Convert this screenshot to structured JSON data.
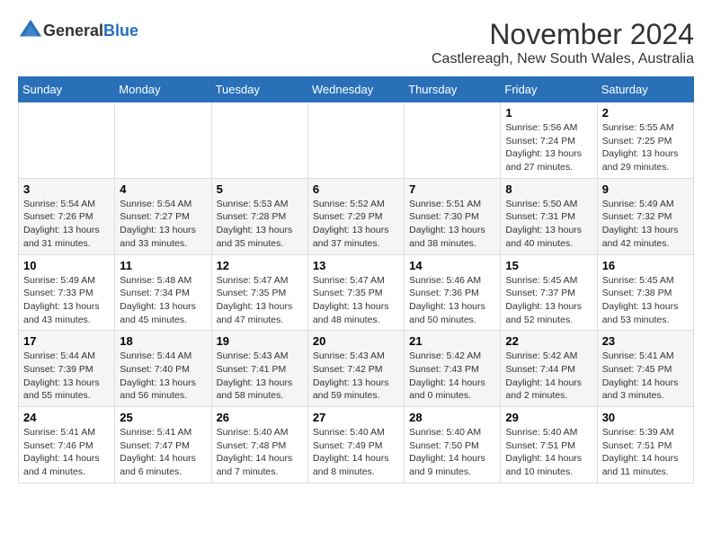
{
  "header": {
    "logo_general": "General",
    "logo_blue": "Blue",
    "month_title": "November 2024",
    "location": "Castlereagh, New South Wales, Australia"
  },
  "weekdays": [
    "Sunday",
    "Monday",
    "Tuesday",
    "Wednesday",
    "Thursday",
    "Friday",
    "Saturday"
  ],
  "weeks": [
    [
      {
        "day": "",
        "info": ""
      },
      {
        "day": "",
        "info": ""
      },
      {
        "day": "",
        "info": ""
      },
      {
        "day": "",
        "info": ""
      },
      {
        "day": "",
        "info": ""
      },
      {
        "day": "1",
        "info": "Sunrise: 5:56 AM\nSunset: 7:24 PM\nDaylight: 13 hours\nand 27 minutes."
      },
      {
        "day": "2",
        "info": "Sunrise: 5:55 AM\nSunset: 7:25 PM\nDaylight: 13 hours\nand 29 minutes."
      }
    ],
    [
      {
        "day": "3",
        "info": "Sunrise: 5:54 AM\nSunset: 7:26 PM\nDaylight: 13 hours\nand 31 minutes."
      },
      {
        "day": "4",
        "info": "Sunrise: 5:54 AM\nSunset: 7:27 PM\nDaylight: 13 hours\nand 33 minutes."
      },
      {
        "day": "5",
        "info": "Sunrise: 5:53 AM\nSunset: 7:28 PM\nDaylight: 13 hours\nand 35 minutes."
      },
      {
        "day": "6",
        "info": "Sunrise: 5:52 AM\nSunset: 7:29 PM\nDaylight: 13 hours\nand 37 minutes."
      },
      {
        "day": "7",
        "info": "Sunrise: 5:51 AM\nSunset: 7:30 PM\nDaylight: 13 hours\nand 38 minutes."
      },
      {
        "day": "8",
        "info": "Sunrise: 5:50 AM\nSunset: 7:31 PM\nDaylight: 13 hours\nand 40 minutes."
      },
      {
        "day": "9",
        "info": "Sunrise: 5:49 AM\nSunset: 7:32 PM\nDaylight: 13 hours\nand 42 minutes."
      }
    ],
    [
      {
        "day": "10",
        "info": "Sunrise: 5:49 AM\nSunset: 7:33 PM\nDaylight: 13 hours\nand 43 minutes."
      },
      {
        "day": "11",
        "info": "Sunrise: 5:48 AM\nSunset: 7:34 PM\nDaylight: 13 hours\nand 45 minutes."
      },
      {
        "day": "12",
        "info": "Sunrise: 5:47 AM\nSunset: 7:35 PM\nDaylight: 13 hours\nand 47 minutes."
      },
      {
        "day": "13",
        "info": "Sunrise: 5:47 AM\nSunset: 7:35 PM\nDaylight: 13 hours\nand 48 minutes."
      },
      {
        "day": "14",
        "info": "Sunrise: 5:46 AM\nSunset: 7:36 PM\nDaylight: 13 hours\nand 50 minutes."
      },
      {
        "day": "15",
        "info": "Sunrise: 5:45 AM\nSunset: 7:37 PM\nDaylight: 13 hours\nand 52 minutes."
      },
      {
        "day": "16",
        "info": "Sunrise: 5:45 AM\nSunset: 7:38 PM\nDaylight: 13 hours\nand 53 minutes."
      }
    ],
    [
      {
        "day": "17",
        "info": "Sunrise: 5:44 AM\nSunset: 7:39 PM\nDaylight: 13 hours\nand 55 minutes."
      },
      {
        "day": "18",
        "info": "Sunrise: 5:44 AM\nSunset: 7:40 PM\nDaylight: 13 hours\nand 56 minutes."
      },
      {
        "day": "19",
        "info": "Sunrise: 5:43 AM\nSunset: 7:41 PM\nDaylight: 13 hours\nand 58 minutes."
      },
      {
        "day": "20",
        "info": "Sunrise: 5:43 AM\nSunset: 7:42 PM\nDaylight: 13 hours\nand 59 minutes."
      },
      {
        "day": "21",
        "info": "Sunrise: 5:42 AM\nSunset: 7:43 PM\nDaylight: 14 hours\nand 0 minutes."
      },
      {
        "day": "22",
        "info": "Sunrise: 5:42 AM\nSunset: 7:44 PM\nDaylight: 14 hours\nand 2 minutes."
      },
      {
        "day": "23",
        "info": "Sunrise: 5:41 AM\nSunset: 7:45 PM\nDaylight: 14 hours\nand 3 minutes."
      }
    ],
    [
      {
        "day": "24",
        "info": "Sunrise: 5:41 AM\nSunset: 7:46 PM\nDaylight: 14 hours\nand 4 minutes."
      },
      {
        "day": "25",
        "info": "Sunrise: 5:41 AM\nSunset: 7:47 PM\nDaylight: 14 hours\nand 6 minutes."
      },
      {
        "day": "26",
        "info": "Sunrise: 5:40 AM\nSunset: 7:48 PM\nDaylight: 14 hours\nand 7 minutes."
      },
      {
        "day": "27",
        "info": "Sunrise: 5:40 AM\nSunset: 7:49 PM\nDaylight: 14 hours\nand 8 minutes."
      },
      {
        "day": "28",
        "info": "Sunrise: 5:40 AM\nSunset: 7:50 PM\nDaylight: 14 hours\nand 9 minutes."
      },
      {
        "day": "29",
        "info": "Sunrise: 5:40 AM\nSunset: 7:51 PM\nDaylight: 14 hours\nand 10 minutes."
      },
      {
        "day": "30",
        "info": "Sunrise: 5:39 AM\nSunset: 7:51 PM\nDaylight: 14 hours\nand 11 minutes."
      }
    ]
  ]
}
